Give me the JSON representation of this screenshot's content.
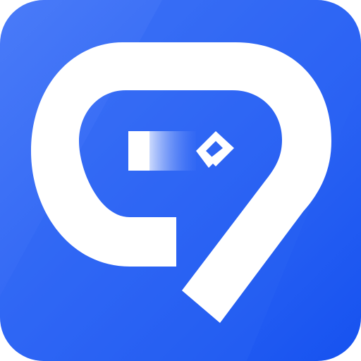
{
  "icon": {
    "name": "app-logo-icon",
    "description_glyph": "9",
    "colors": {
      "background_light": "#4a7bf8",
      "background_dark": "#1652f0",
      "accent_top_right": "#2b6ff6",
      "glyph": "#ffffff",
      "slider_fill_start": "#ffffff",
      "slider_fill_end": "#3a6df5"
    }
  }
}
